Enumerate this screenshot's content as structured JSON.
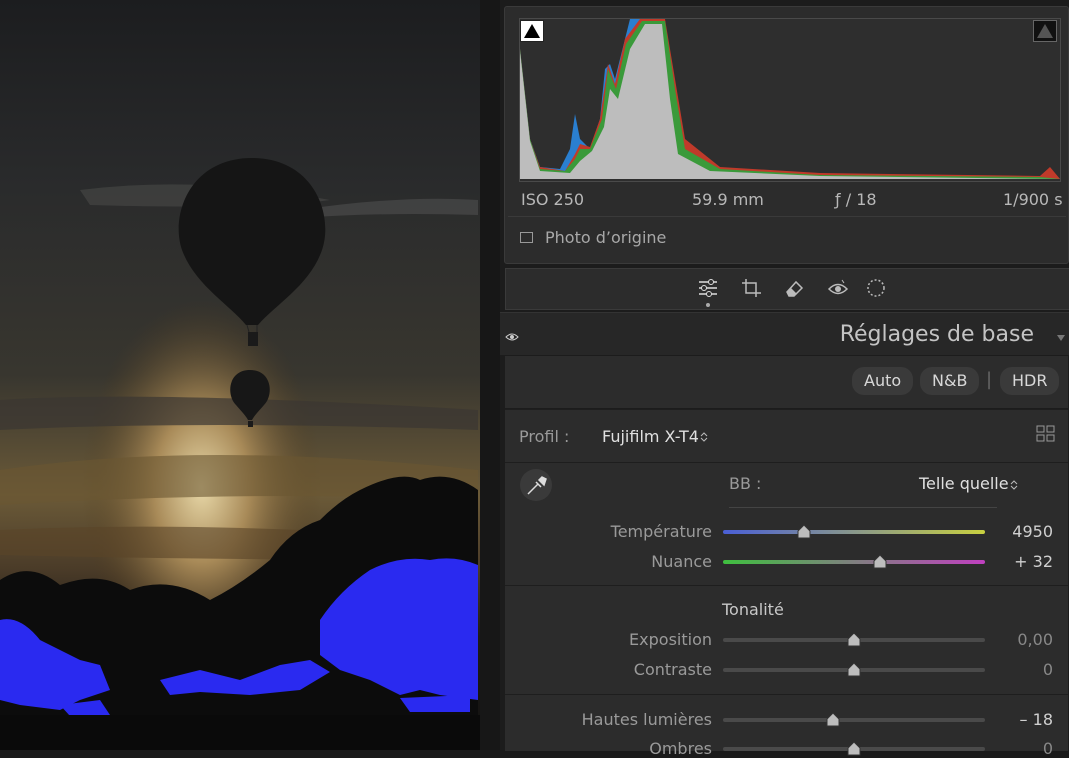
{
  "photo": {
    "alt_icon": "hot-air-balloon-photo"
  },
  "histogram": {
    "iso": "ISO 250",
    "focal": "59.9 mm",
    "aperture": "ƒ / 18",
    "shutter": "1/900 s",
    "original_photo_label": "Photo d’origine"
  },
  "tools": [
    "edit-sliders-icon",
    "crop-icon",
    "eraser-icon",
    "redeye-icon",
    "masking-icon"
  ],
  "section": {
    "title": "Réglages de base"
  },
  "buttons": {
    "auto": "Auto",
    "bw": "N&B",
    "sep": "|",
    "hdr": "HDR"
  },
  "profile": {
    "label": "Profil :",
    "value": "Fujifilm X-T4",
    "arrow": "⌃"
  },
  "wb": {
    "label": "BB :",
    "value": "Telle quelle"
  },
  "sliders": {
    "temperature": {
      "label": "Température",
      "value": "4950",
      "pos": 0.31
    },
    "tint": {
      "label": "Nuance",
      "value": "+ 32",
      "pos": 0.6
    },
    "exposure": {
      "label": "Exposition",
      "value": "0,00",
      "pos": 0.5
    },
    "contrast": {
      "label": "Contraste",
      "value": "0",
      "pos": 0.5
    },
    "highlights": {
      "label": "Hautes lumières",
      "value": "– 18",
      "pos": 0.42
    },
    "shadows": {
      "label": "Ombres",
      "value": "0",
      "pos": 0.5
    }
  },
  "tone": {
    "label": "Tonalité"
  },
  "colors": {
    "temp_start": "#4a5fd6",
    "temp_end": "#c8d040",
    "tint_start": "#3fbf3f",
    "tint_end": "#c040c0"
  }
}
